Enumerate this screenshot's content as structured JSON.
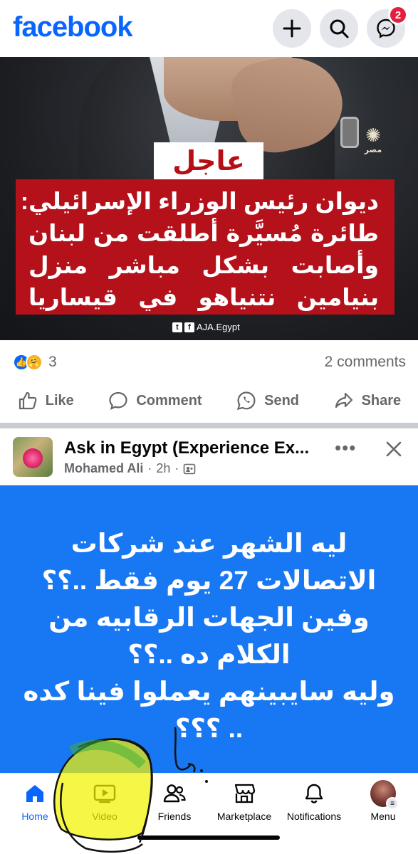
{
  "header": {
    "logo": "facebook",
    "messenger_badge": "2",
    "icons": [
      "plus-icon",
      "search-icon",
      "messenger-icon"
    ]
  },
  "news_post": {
    "image_label_urgent": "عاجل",
    "headline_lines": [
      "ديوان رئيس الوزراء الإسرائيلي:",
      "طائرة مُسيَّرة أطلقت من لبنان",
      "وأصابت بشكل مباشر منزل",
      "بنيامين نتنياهو في قيساريا"
    ],
    "channel_logo_sub": "مصر",
    "social_handle": "AJA.Egypt",
    "reaction_count": "3",
    "comments_count": "2 comments",
    "actions": {
      "like": "Like",
      "comment": "Comment",
      "send": "Send",
      "share": "Share"
    }
  },
  "group_post": {
    "group_name": "Ask in Egypt (Experience Ex...",
    "author": "Mohamed Ali",
    "time": "2h",
    "text_lines": [
      "ليه الشهر عند شركات",
      "الاتصالات 27 يوم فقط ..؟؟",
      "وفين الجهات الرقابيه من",
      "الكلام ده ..؟؟",
      "وليه سايبينهم يعملوا فينا كده",
      ".. ؟؟؟"
    ]
  },
  "tabbar": {
    "home": "Home",
    "video": "Video",
    "friends": "Friends",
    "marketplace": "Marketplace",
    "notifications": "Notifications",
    "menu": "Menu"
  },
  "colors": {
    "brand": "#0866ff",
    "urgent_red": "#b5111a",
    "post_background": "#1877f2",
    "badge": "#e41e3f"
  }
}
